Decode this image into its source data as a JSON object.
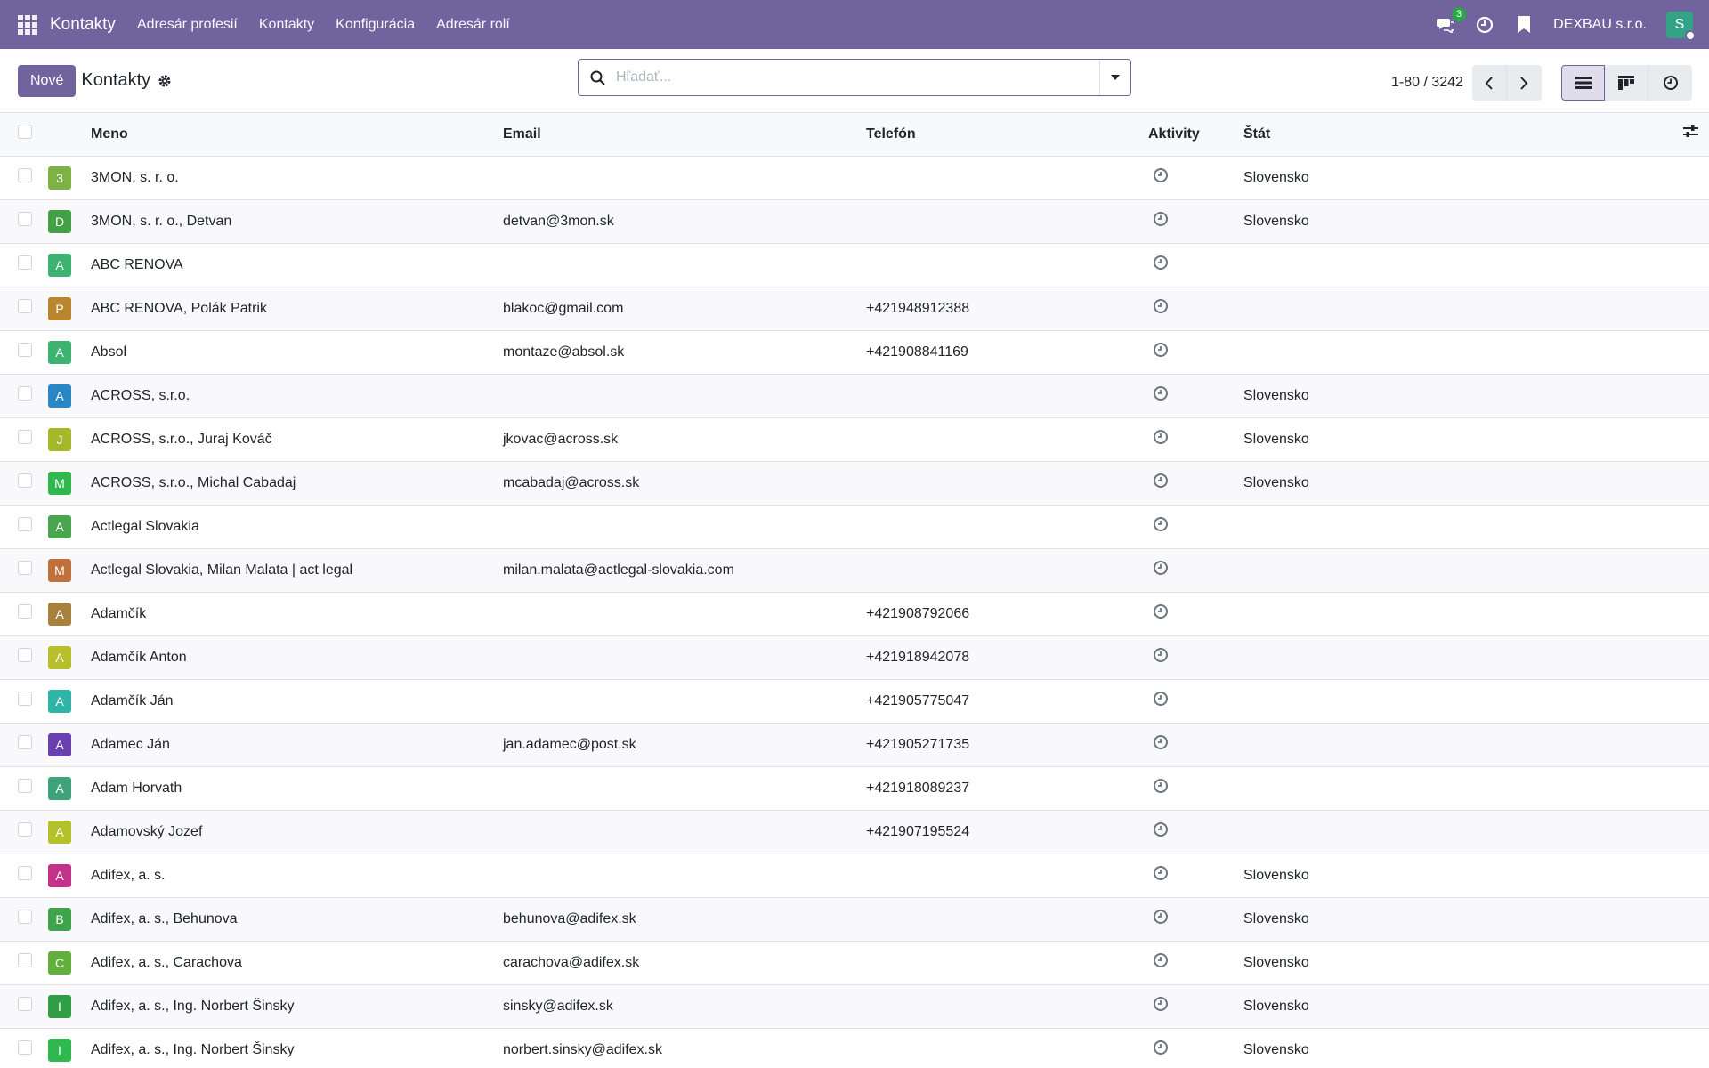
{
  "navbar": {
    "brand": "Kontakty",
    "menu": [
      "Adresár profesií",
      "Kontakty",
      "Konfigurácia",
      "Adresár rolí"
    ],
    "messages_badge": "3",
    "company": "DEXBAU s.r.o.",
    "user_initial": "S"
  },
  "control": {
    "new_label": "Nové",
    "title": "Kontakty",
    "search_placeholder": "Hľadať...",
    "pager": "1-80 / 3242"
  },
  "table": {
    "headers": {
      "name": "Meno",
      "email": "Email",
      "phone": "Telefón",
      "activities": "Aktivity",
      "country": "Štát"
    },
    "rows": [
      {
        "initial": "3",
        "color": "#7cb342",
        "name": "3MON, s. r. o.",
        "email": "",
        "phone": "",
        "country": "Slovensko"
      },
      {
        "initial": "D",
        "color": "#43a047",
        "name": "3MON, s. r. o., Detvan",
        "email": "detvan@3mon.sk",
        "phone": "",
        "country": "Slovensko"
      },
      {
        "initial": "A",
        "color": "#3cb371",
        "name": "ABC RENOVA",
        "email": "",
        "phone": "",
        "country": ""
      },
      {
        "initial": "P",
        "color": "#b8862e",
        "name": "ABC RENOVA, Polák Patrik",
        "email": "blakoc@gmail.com",
        "phone": "+421948912388",
        "country": ""
      },
      {
        "initial": "A",
        "color": "#3cb371",
        "name": "Absol",
        "email": "montaze@absol.sk",
        "phone": "+421908841169",
        "country": ""
      },
      {
        "initial": "A",
        "color": "#2b86c5",
        "name": "ACROSS, s.r.o.",
        "email": "",
        "phone": "",
        "country": "Slovensko"
      },
      {
        "initial": "J",
        "color": "#a5b82a",
        "name": "ACROSS, s.r.o., Juraj Kováč",
        "email": "jkovac@across.sk",
        "phone": "",
        "country": "Slovensko"
      },
      {
        "initial": "M",
        "color": "#2fb84e",
        "name": "ACROSS, s.r.o., Michal Cabadaj",
        "email": "mcabadaj@across.sk",
        "phone": "",
        "country": "Slovensko"
      },
      {
        "initial": "A",
        "color": "#49a64f",
        "name": "Actlegal Slovakia",
        "email": "",
        "phone": "",
        "country": ""
      },
      {
        "initial": "M",
        "color": "#c0703a",
        "name": "Actlegal Slovakia, Milan Malata | act legal",
        "email": "milan.malata@actlegal-slovakia.com",
        "phone": "",
        "country": ""
      },
      {
        "initial": "A",
        "color": "#a8823c",
        "name": "Adamčík",
        "email": "",
        "phone": "+421908792066",
        "country": ""
      },
      {
        "initial": "A",
        "color": "#b7bf2c",
        "name": "Adamčík Anton",
        "email": "",
        "phone": "+421918942078",
        "country": ""
      },
      {
        "initial": "A",
        "color": "#2fb5a8",
        "name": "Adamčík Ján",
        "email": "",
        "phone": "+421905775047",
        "country": ""
      },
      {
        "initial": "A",
        "color": "#6a3fb0",
        "name": "Adamec Ján",
        "email": "jan.adamec@post.sk",
        "phone": "+421905271735",
        "country": ""
      },
      {
        "initial": "A",
        "color": "#3fa37a",
        "name": "Adam Horvath",
        "email": "",
        "phone": "+421918089237",
        "country": ""
      },
      {
        "initial": "A",
        "color": "#b5c12a",
        "name": "Adamovský Jozef",
        "email": "",
        "phone": "+421907195524",
        "country": ""
      },
      {
        "initial": "A",
        "color": "#c2328a",
        "name": "Adifex, a. s.",
        "email": "",
        "phone": "",
        "country": "Slovensko"
      },
      {
        "initial": "B",
        "color": "#3ea34a",
        "name": "Adifex, a. s., Behunova",
        "email": "behunova@adifex.sk",
        "phone": "",
        "country": "Slovensko"
      },
      {
        "initial": "C",
        "color": "#62b03c",
        "name": "Adifex, a. s., Carachova",
        "email": "carachova@adifex.sk",
        "phone": "",
        "country": "Slovensko"
      },
      {
        "initial": "I",
        "color": "#2f9e45",
        "name": "Adifex, a. s., Ing. Norbert Šinsky",
        "email": "sinsky@adifex.sk",
        "phone": "",
        "country": "Slovensko"
      },
      {
        "initial": "I",
        "color": "#2fb84e",
        "name": "Adifex, a. s., Ing. Norbert Šinsky",
        "email": "norbert.sinsky@adifex.sk",
        "phone": "",
        "country": "Slovensko"
      }
    ]
  },
  "icons": {
    "apps": "apps-grid-icon",
    "messages": "chat-bubble-icon",
    "activity": "clock-icon",
    "bookmark": "bookmark-icon",
    "search": "search-icon",
    "settings": "gear-icon",
    "optional_columns": "sliders-icon"
  }
}
